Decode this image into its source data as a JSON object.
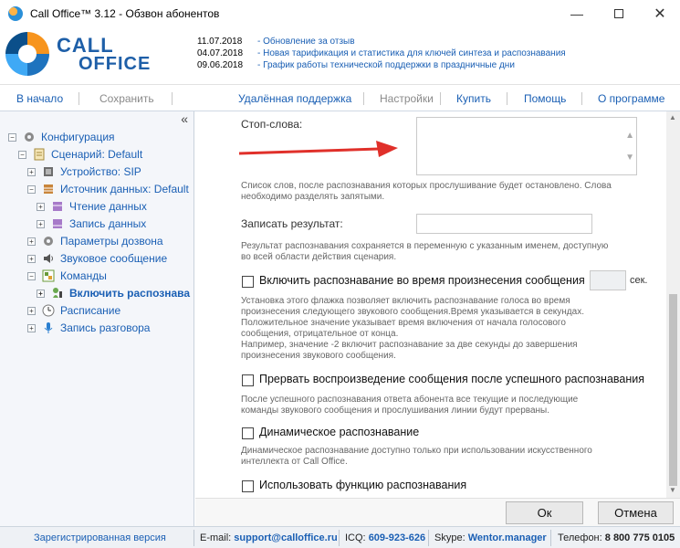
{
  "window": {
    "title": "Call Office™ 3.12 - Обзвон абонентов",
    "minimize_glyph": "—",
    "close_glyph": "✕"
  },
  "logo": {
    "line1": "CALL",
    "line2": "OFFICE"
  },
  "news": [
    {
      "date": "11.07.2018",
      "text": "- Обновление за отзыв"
    },
    {
      "date": "04.07.2018",
      "text": "- Новая тарификация и статистика для ключей синтеза и распознавания"
    },
    {
      "date": "09.06.2018",
      "text": "- График работы технической поддержки в праздничные дни"
    }
  ],
  "toolbar": {
    "home": "В начало",
    "save": "Сохранить",
    "remote": "Удалённая поддержка",
    "settings": "Настройки",
    "buy": "Купить",
    "help": "Помощь",
    "about": "О программе"
  },
  "sidebar": {
    "collapse_glyph": "«",
    "items": [
      {
        "label": "Конфигурация",
        "icon": "gear-icon"
      },
      {
        "label": "Сценарий: Default",
        "icon": "script-icon"
      },
      {
        "label": "Устройство: SIP",
        "icon": "device-icon"
      },
      {
        "label": "Источник данных: Default",
        "icon": "database-icon"
      },
      {
        "label": "Чтение данных",
        "icon": "database-read-icon"
      },
      {
        "label": "Запись данных",
        "icon": "database-write-icon"
      },
      {
        "label": "Параметры дозвона",
        "icon": "gear-icon"
      },
      {
        "label": "Звуковое сообщение",
        "icon": "speaker-icon"
      },
      {
        "label": "Команды",
        "icon": "commands-icon"
      },
      {
        "label": "Включить распознава",
        "icon": "recognition-icon"
      },
      {
        "label": "Расписание",
        "icon": "clock-icon"
      },
      {
        "label": "Запись разговора",
        "icon": "microphone-icon"
      }
    ]
  },
  "form": {
    "stopwords_label": "Стоп-слова:",
    "stopwords_value": "",
    "stopwords_desc": [
      "Список слов, после распознавания которых прослушивание будет остановлено. Слова",
      "необходимо разделять запятыми."
    ],
    "record_label": "Записать результат:",
    "record_value": "",
    "record_desc": [
      "Результат распознавания сохраняется в переменную с указанным именем, доступную",
      "во всей области действия сценария."
    ],
    "during_msg_label": "Включить распознавание во время произнесения сообщения",
    "during_msg_value": "",
    "during_msg_unit": "сек.",
    "during_msg_desc": [
      "Установка этого флажка позволяет включить распознавание голоса во время",
      "произнесения следующего звукового сообщения.Время указывается в секундах.",
      "Положительное значение указывает время включения от начала голосового",
      "сообщения, отрицательное от конца.",
      "Например, значение -2 включит распознавание за две секунды до завершения",
      "произнесения звукового сообщения."
    ],
    "interrupt_label": "Прервать воспроизведение сообщения после успешного распознавания",
    "interrupt_desc": [
      "После успешного распознавания ответа абонента все текущие и последующие",
      "команды звукового сообщения и прослушивания линии будут прерваны."
    ],
    "dynamic_label": "Динамическое распознавание",
    "dynamic_desc": [
      "Динамическое распознавание доступно только при использовании искусственного",
      "интеллекта от Call Office."
    ],
    "use_function_label": "Использовать функцию распознавания"
  },
  "buttons": {
    "ok": "Ок",
    "cancel": "Отмена"
  },
  "status": {
    "registered": "Зарегистрированная версия",
    "email_label": "E-mail:",
    "email": "support@calloffice.ru",
    "icq_label": "ICQ:",
    "icq": "609-923-626",
    "skype_label": "Skype:",
    "skype": "Wentor.manager",
    "phone_label": "Телефон:",
    "phone": "8 800 775 0105"
  },
  "colors": {
    "link": "#1a5fb4",
    "arrow": "#e0302a",
    "logo": "#1e5fa8"
  }
}
